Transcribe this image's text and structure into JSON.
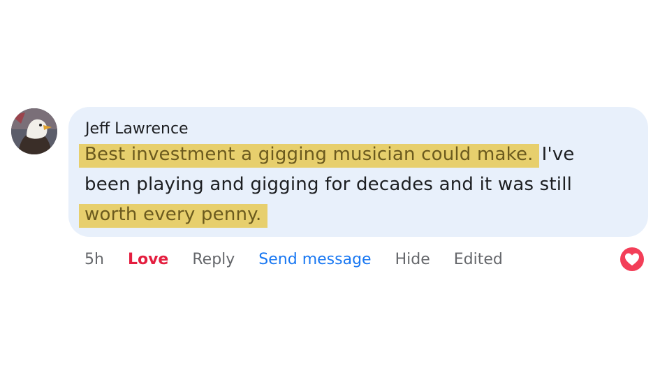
{
  "comment": {
    "author": "Jeff Lawrence",
    "lines": [
      {
        "highlight": "Best investment a gigging musician could make.",
        "rest": "I've"
      },
      {
        "text": "been playing and gigging for decades and it was still"
      },
      {
        "highlight": "worth every penny."
      }
    ]
  },
  "actions": {
    "time": "5h",
    "love": "Love",
    "reply": "Reply",
    "send_message": "Send message",
    "hide": "Hide",
    "edited": "Edited"
  },
  "reaction": {
    "icon": "heart-icon",
    "color": "#f33e58"
  },
  "colors": {
    "bubble": "#e8f0fb",
    "highlight": "#e7cf6d",
    "love": "#e41e3f",
    "link": "#1877f2",
    "muted": "#65676b"
  },
  "avatar": {
    "icon": "eagle-avatar"
  }
}
